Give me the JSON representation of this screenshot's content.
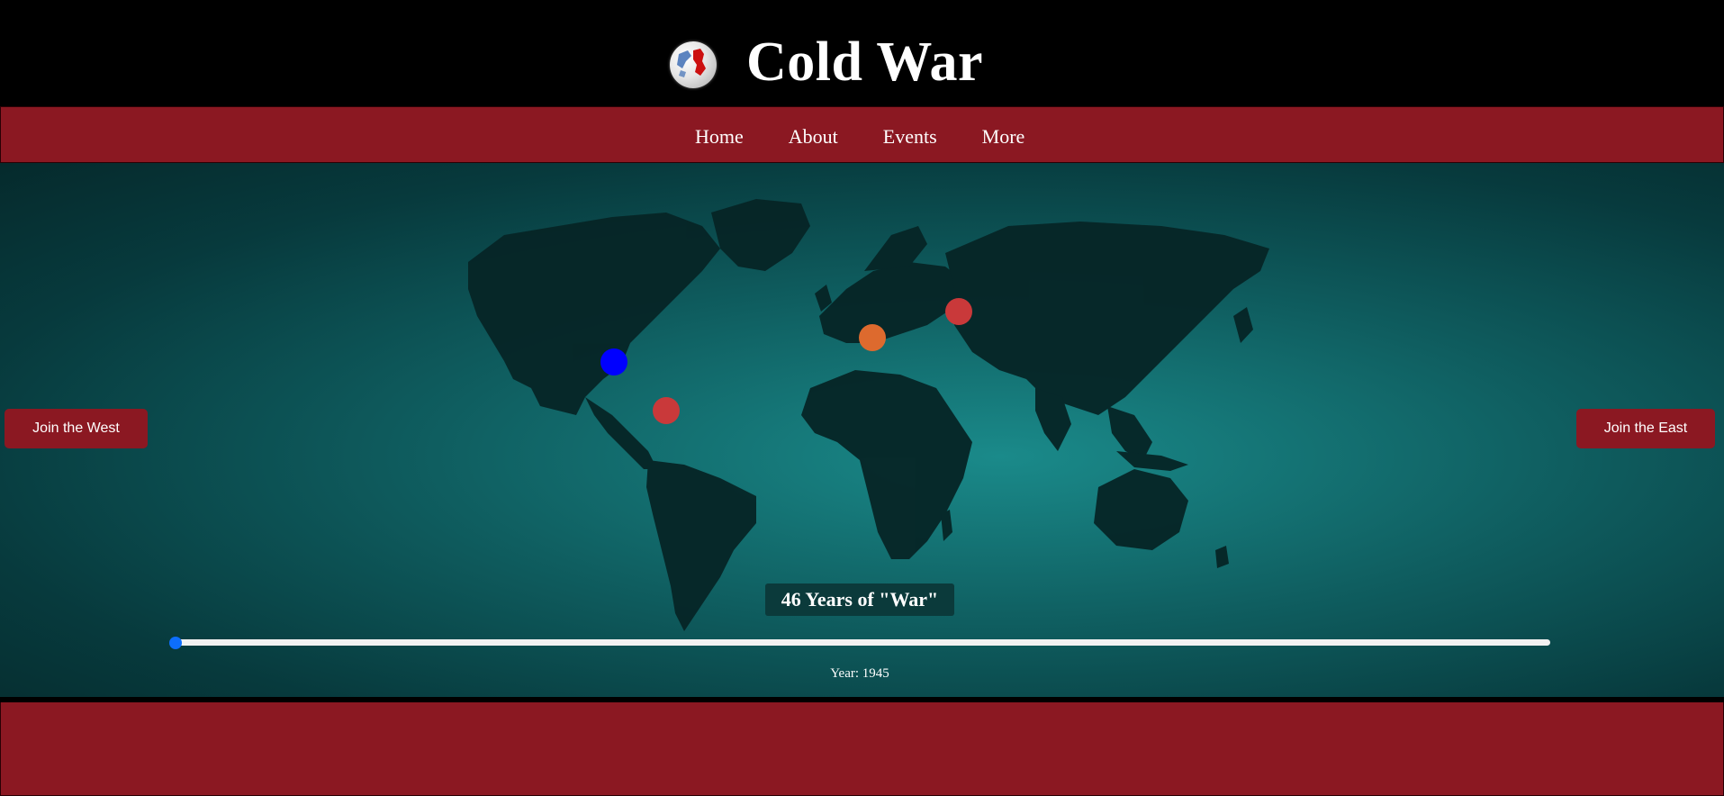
{
  "header": {
    "title": "Cold War",
    "logo_icon": "globe-icon"
  },
  "nav": {
    "items": [
      "Home",
      "About",
      "Events",
      "More"
    ]
  },
  "map": {
    "join_west_label": "Join the West",
    "join_east_label": "Join the East",
    "markers": [
      {
        "name": "usa",
        "color": "#0000ff"
      },
      {
        "name": "cuba",
        "color": "#c9393a"
      },
      {
        "name": "europe",
        "color": "#dd6a2e"
      },
      {
        "name": "ussr",
        "color": "#c9393a"
      }
    ]
  },
  "timeline": {
    "headline": "46 Years of \"War\"",
    "year_text": "Year: 1945",
    "min_year": 1945,
    "max_year": 1991,
    "current_year": 1945,
    "track_color": "#f2f2f2",
    "thumb_color": "#0d6efd"
  },
  "colors": {
    "accent": "#8b1822",
    "header_bg": "#000000",
    "ocean": "#0f5e60"
  }
}
